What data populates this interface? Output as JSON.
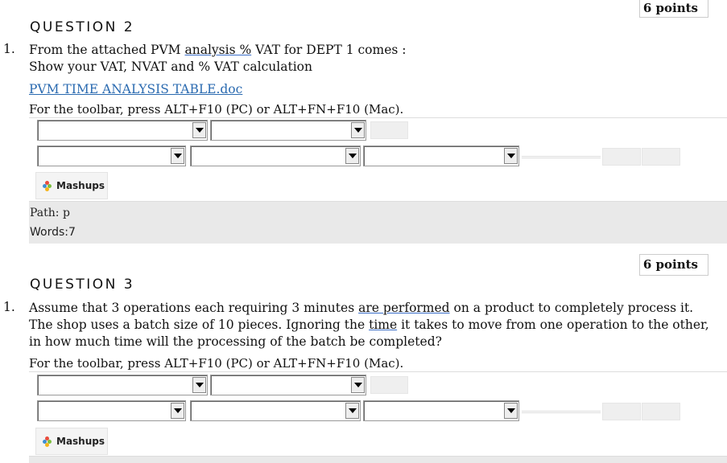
{
  "question2": {
    "points": "6 points",
    "title": "QUESTION 2",
    "number": "1.",
    "text_part1": "From the attached PVM ",
    "text_analysis": "analysis  %",
    "text_part2": " VAT for DEPT 1 comes :",
    "text_line2": "Show  your VAT, NVAT and % VAT calculation",
    "attachment_link": "PVM TIME ANALYSIS TABLE.doc",
    "toolbar_hint": "For the toolbar, press ALT+F10 (PC) or ALT+FN+F10 (Mac).",
    "mashups_label": "Mashups",
    "path_label": "Path:",
    "path_value": "p",
    "words_label": "Words:",
    "words_value": "7"
  },
  "question3": {
    "points": "6 points",
    "title": "QUESTION 3",
    "number": "1.",
    "text_a": "Assume that 3 operations each requiring 3 minutes ",
    "text_are_performed": "are  performed",
    "text_b": " on a product to completely process it. The shop uses a batch size of 10 pieces. Ignoring the ",
    "text_time": "time",
    "text_c": " it takes to move from one operation to the other, in how much time will the processing of the batch be completed?",
    "toolbar_hint": "For the toolbar, press ALT+F10 (PC) or ALT+FN+F10 (Mac).",
    "mashups_label": "Mashups"
  },
  "colors": {
    "link": "#2a6ab0",
    "status_bar": "#e9e9e9",
    "mashups_icon": [
      "#e94b3c",
      "#3f8fd2",
      "#7cbf3f",
      "#f5b41a"
    ]
  }
}
